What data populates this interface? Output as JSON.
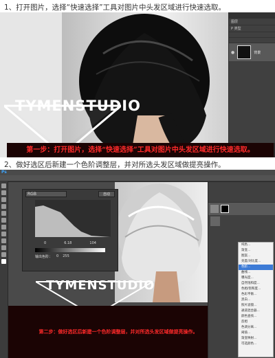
{
  "step1": {
    "caption": "1、打开图片，选择“快速选择”工具对图片中头发区域进行快速选取。",
    "banner": "第一步：打开图片，选择“快速选择”工具对图片中头发区域进行快速选取。",
    "logo": "TYMENSTUDIO",
    "panel": {
      "tabs": [
        "图层"
      ],
      "kind": "P 类型",
      "layers": [
        "背景"
      ]
    }
  },
  "step2": {
    "caption": "2、做好选区后新建一个色阶调整层，并对所选头发区域做提亮操作。",
    "banner": "第二步：做好选区后新建一个色阶调整层，并对所选头发区域做提亮操作。",
    "logo": "TYMENSTUDIO",
    "dialog": {
      "channel": "RGB",
      "auto_label": "自动",
      "input_values": [
        "0",
        "6.18",
        "104"
      ],
      "output_label": "输出色阶：",
      "output_values": [
        "0",
        "255"
      ]
    },
    "ps_logo": "Ps",
    "context_menu": [
      "纯色...",
      "渐变...",
      "图案...",
      "亮度/对比度...",
      "色阶...",
      "曲线...",
      "曝光度...",
      "自然饱和度...",
      "色相/饱和度...",
      "色彩平衡...",
      "黑白...",
      "照片滤镜...",
      "通道混合器...",
      "颜色查找...",
      "反相",
      "色调分离...",
      "阈值...",
      "渐变映射...",
      "可选颜色..."
    ]
  },
  "colors": {
    "accent_red": "#ff2a2a",
    "banner_bg": "#1b0404",
    "ps_dark": "#282828"
  }
}
